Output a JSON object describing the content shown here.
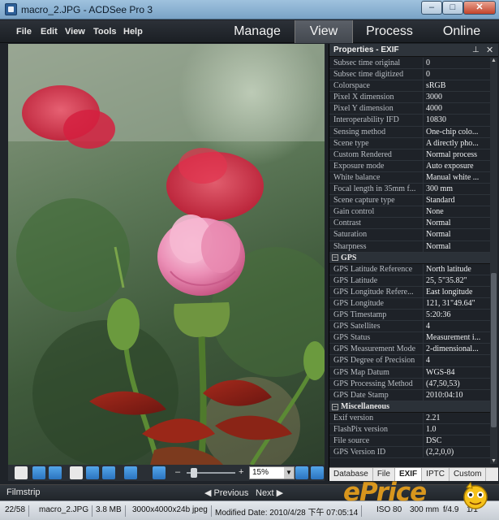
{
  "window": {
    "title": "macro_2.JPG - ACDSee Pro 3",
    "min_label": "–",
    "max_label": "□",
    "close_label": "✕"
  },
  "menu": [
    "File",
    "Edit",
    "View",
    "Tools",
    "Help"
  ],
  "modes": [
    "Manage",
    "View",
    "Process",
    "Online"
  ],
  "active_mode": "View",
  "viewer_toolbar": {
    "zoom": "15%",
    "zoom_minus": "–",
    "zoom_plus": "+",
    "icons": [
      "filmstrip-icon",
      "rotate-left-icon",
      "rotate-right-icon",
      "hand-icon",
      "select-icon",
      "magnifier-icon",
      "resize-icon",
      "fit-icon",
      "actual-size-icon",
      "fit-window-icon"
    ]
  },
  "properties": {
    "title": "Properties - EXIF",
    "rows": [
      {
        "k": "Subsec time original",
        "v": "0"
      },
      {
        "k": "Subsec time digitized",
        "v": "0"
      },
      {
        "k": "Colorspace",
        "v": "sRGB"
      },
      {
        "k": "Pixel X dimension",
        "v": "3000"
      },
      {
        "k": "Pixel Y dimension",
        "v": "4000"
      },
      {
        "k": "Interoperability IFD",
        "v": "10830"
      },
      {
        "k": "Sensing method",
        "v": "One-chip colo..."
      },
      {
        "k": "Scene type",
        "v": "A directly pho..."
      },
      {
        "k": "Custom Rendered",
        "v": "Normal process"
      },
      {
        "k": "Exposure mode",
        "v": "Auto exposure"
      },
      {
        "k": "White balance",
        "v": "Manual white ..."
      },
      {
        "k": "Focal length in 35mm f...",
        "v": "300 mm"
      },
      {
        "k": "Scene capture type",
        "v": "Standard"
      },
      {
        "k": "Gain control",
        "v": "None"
      },
      {
        "k": "Contrast",
        "v": "Normal"
      },
      {
        "k": "Saturation",
        "v": "Normal"
      },
      {
        "k": "Sharpness",
        "v": "Normal"
      }
    ],
    "gps_label": "GPS",
    "gps_rows": [
      {
        "k": "GPS Latitude Reference",
        "v": "North latitude"
      },
      {
        "k": "GPS Latitude",
        "v": "25, 5\"35.82\""
      },
      {
        "k": "GPS Longitude Refere...",
        "v": "East longitude"
      },
      {
        "k": "GPS Longitude",
        "v": "121, 31\"49.64\""
      },
      {
        "k": "GPS Timestamp",
        "v": "5:20:36"
      },
      {
        "k": "GPS Satellites",
        "v": "4"
      },
      {
        "k": "GPS Status",
        "v": "Measurement i..."
      },
      {
        "k": "GPS Measurement Mode",
        "v": "2-dimensional..."
      },
      {
        "k": "GPS Degree of Precision",
        "v": "4"
      },
      {
        "k": "GPS Map Datum",
        "v": "WGS-84"
      },
      {
        "k": "GPS Processing Method",
        "v": "(47,50,53)"
      },
      {
        "k": "GPS Date Stamp",
        "v": "2010:04:10"
      }
    ],
    "misc_label": "Miscellaneous",
    "misc_rows": [
      {
        "k": "Exif version",
        "v": "2.21"
      },
      {
        "k": "FlashPix version",
        "v": "1.0"
      },
      {
        "k": "File source",
        "v": "DSC"
      },
      {
        "k": "GPS Version ID",
        "v": "(2,2,0,0)"
      }
    ],
    "tabs": [
      "Database",
      "File",
      "EXIF",
      "IPTC",
      "Custom"
    ],
    "active_tab": "EXIF"
  },
  "filmstrip": {
    "label": "Filmstrip",
    "previous": "◀ Previous",
    "next": "Next ▶"
  },
  "status": {
    "count": "22/58",
    "file": "macro_2.JPG",
    "size": "3.8 MB",
    "dimensions": "3000x4000x24b jpeg",
    "modified": "Modified Date: 2010/4/28 下午 07:05:14",
    "iso": "ISO 80",
    "focal": "300 mm",
    "fnumber": "f/4.9",
    "exposure": "1/1"
  },
  "watermark": "ePrice",
  "colors": {
    "accent_blue": "#2b74bf",
    "rose_pink": "#e37fa8",
    "rose_red": "#d5203f",
    "watermark_orange": "#ffad19"
  }
}
